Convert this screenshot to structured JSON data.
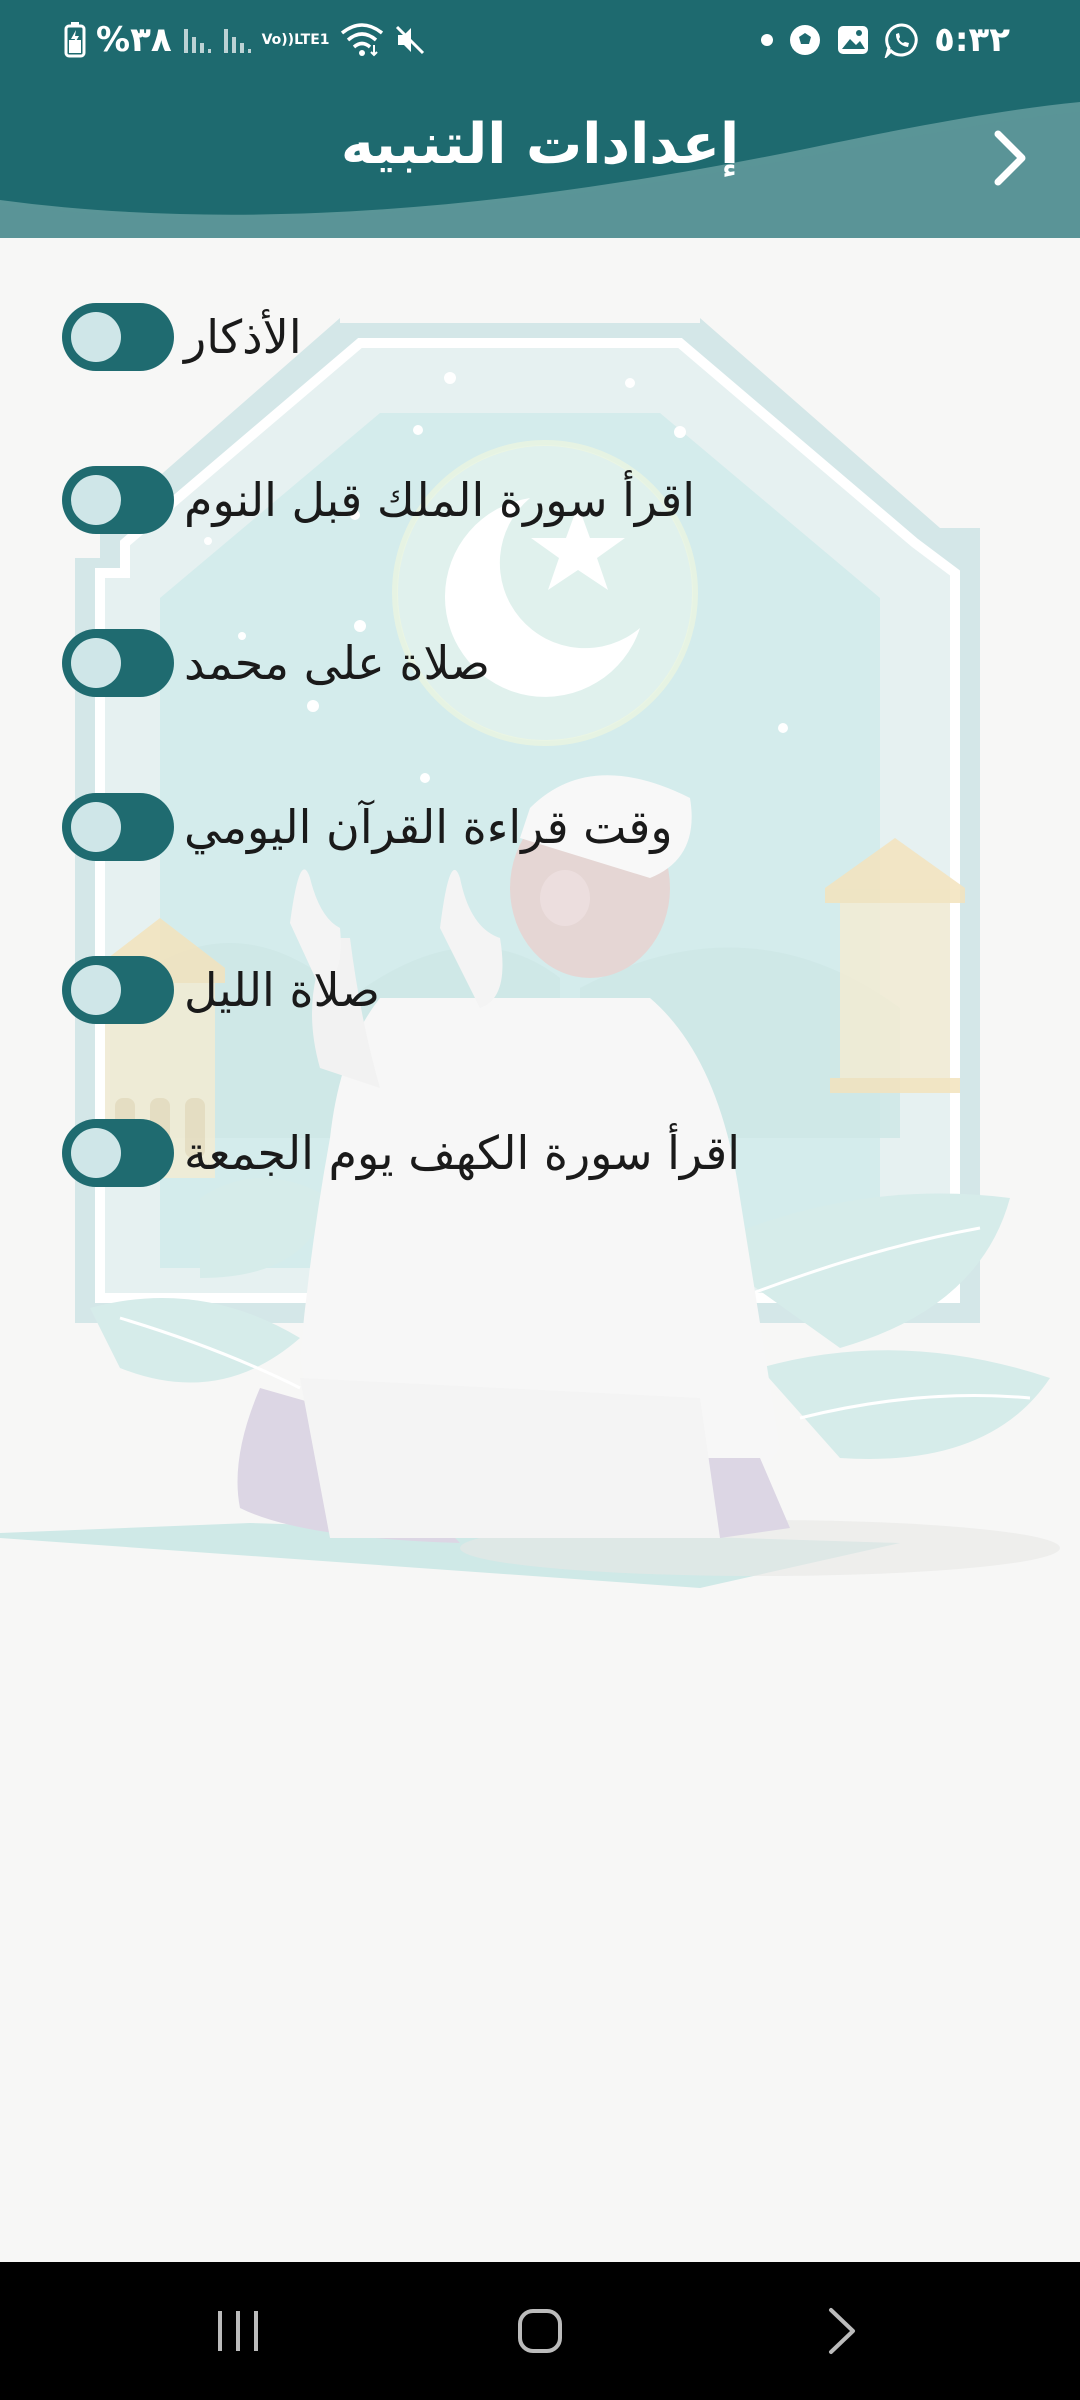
{
  "status_bar": {
    "time": "٥:٣٢",
    "battery": "%٣٨",
    "lte_line1": "Vo))",
    "lte_line2": "LTE1",
    "notification_icons": [
      "dot-icon",
      "football-icon",
      "gallery-icon",
      "whatsapp-icon"
    ],
    "system_icons": [
      "battery-charging-icon",
      "signal-icon",
      "signal-icon",
      "volte-icon",
      "wifi-icon",
      "mute-icon"
    ]
  },
  "header": {
    "title": "إعدادات التنبيه",
    "back_icon": "chevron-right-icon"
  },
  "settings": [
    {
      "label": "الأذكار",
      "enabled": true
    },
    {
      "label": "اقرأ سورة الملك قبل النوم",
      "enabled": true
    },
    {
      "label": "صلاة على محمد",
      "enabled": true
    },
    {
      "label": "وقت قراءة القرآن اليومي",
      "enabled": true
    },
    {
      "label": "صلاة الليل",
      "enabled": true
    },
    {
      "label": "اقرأ سورة الكهف يوم الجمعة",
      "enabled": true
    }
  ],
  "nav_bar": {
    "buttons": [
      "recent-apps-icon",
      "home-icon",
      "back-icon"
    ]
  },
  "colors": {
    "header": "#1e6a6f",
    "header_light": "#5a9597",
    "toggle": "#1f6b70",
    "toggle_knob": "#cfe6e8",
    "background": "#f7f7f6",
    "nav_bar": "#000000"
  }
}
